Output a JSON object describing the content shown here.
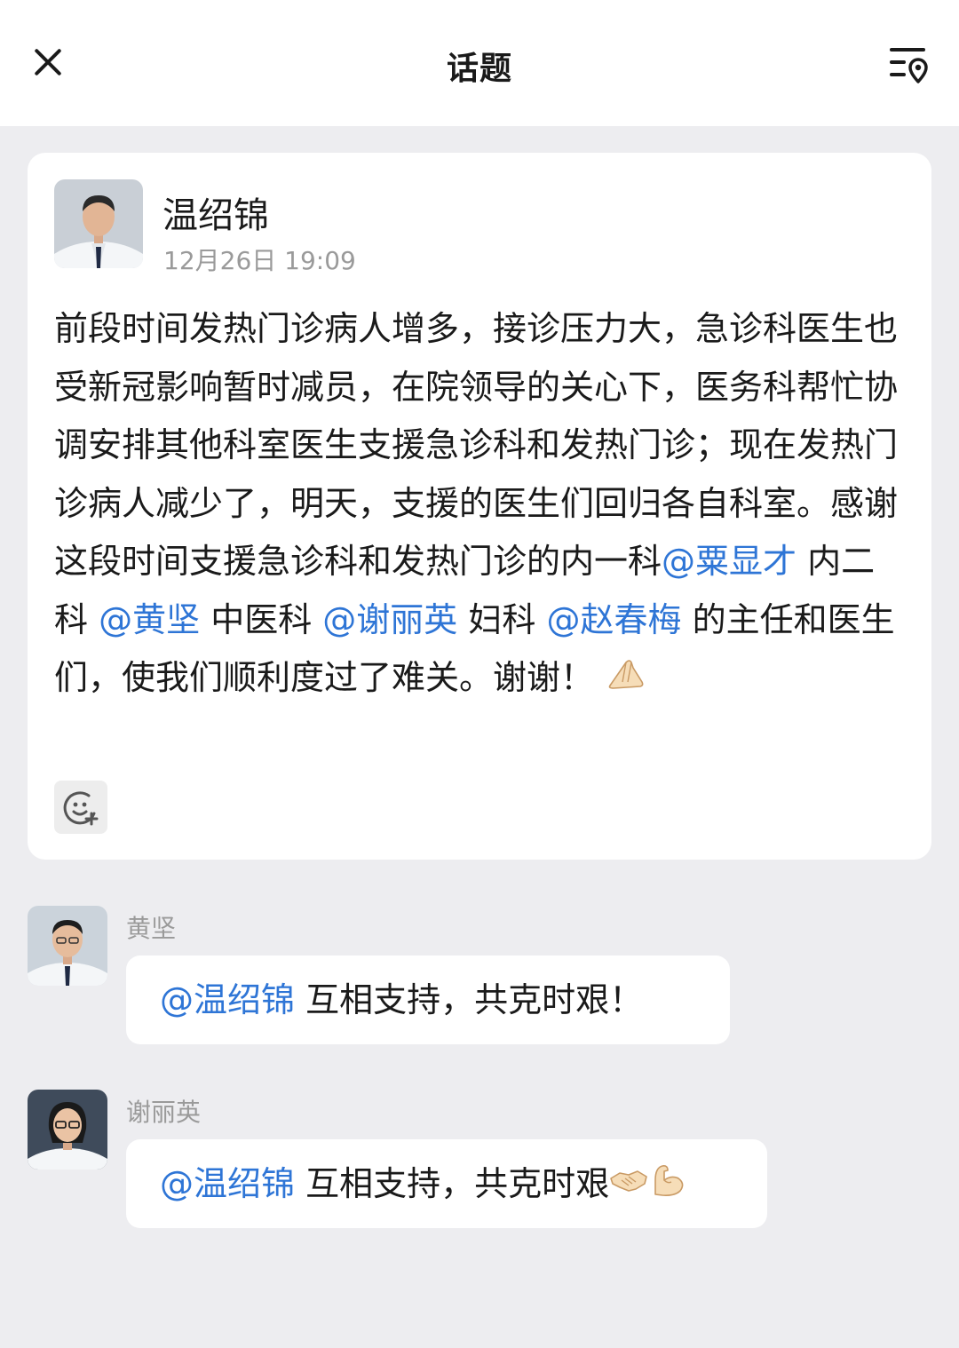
{
  "header": {
    "title": "话题",
    "close_icon": "close-icon",
    "menu_icon": "list-location-icon"
  },
  "post": {
    "author": "温绍锦",
    "time": "12月26日 19:09",
    "body_text_1": "前段时间发热门诊病人增多，接诊压力大，急诊科医生也受新冠影响暂时减员，在院领导的关心下，医务科帮忙协调安排其他科室医生支援急诊科和发热门诊；现在发热门诊病人减少了，明天，支援的医生们回归各自科室。感谢这段时间支援急诊科和发热门诊的内一科",
    "mention_1": "@粟显才",
    "body_text_2": " 内二科 ",
    "mention_2": "@黄坚",
    "body_text_3": " 中医科 ",
    "mention_3": "@谢丽英",
    "body_text_4": " 妇科 ",
    "mention_4": "@赵春梅",
    "body_text_5": " 的主任和医生们，使我们顺利度过了难关。谢谢！",
    "emoji": "praying-hands",
    "reaction_icon": "add-reaction-icon"
  },
  "comments": [
    {
      "name": "黄坚",
      "mention": "@温绍锦",
      "text": " 互相支持，共克时艰！"
    },
    {
      "name": "谢丽英",
      "mention": "@温绍锦",
      "text": " 互相支持，共克时艰",
      "emojis": [
        "handshake",
        "flexed-biceps"
      ]
    }
  ],
  "colors": {
    "background": "#EDEDF0",
    "card": "#FFFFFF",
    "mention": "#2E75D6",
    "meta_text": "#9A9A9A"
  }
}
